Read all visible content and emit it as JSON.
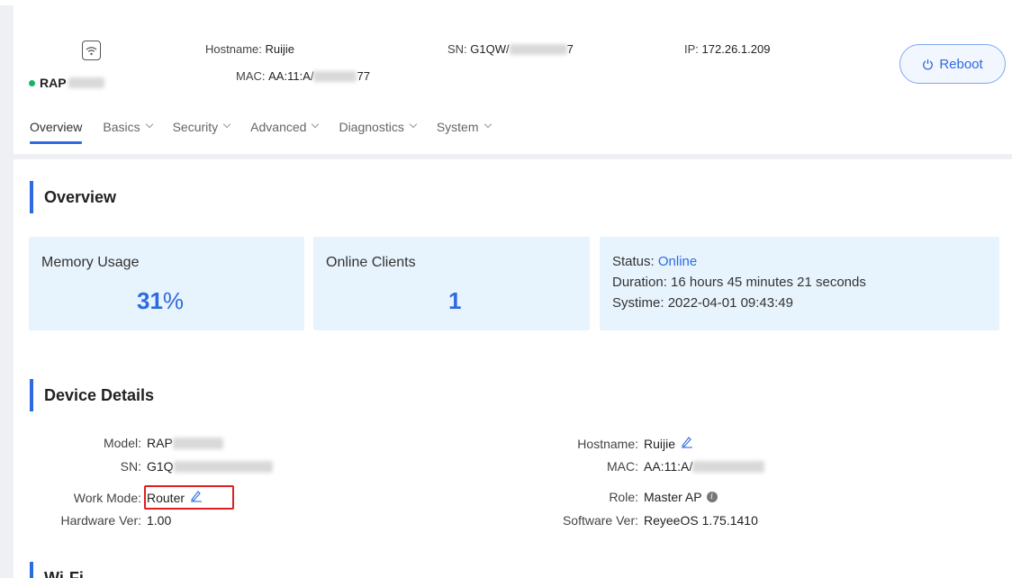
{
  "header": {
    "device_name": "RAP",
    "hostname_label": "Hostname:",
    "hostname_value": "Ruijie",
    "mac_label": "MAC:",
    "mac_prefix": "AA:11:A/",
    "mac_suffix": "77",
    "sn_label": "SN:",
    "sn_prefix": "G1QW/",
    "sn_suffix": "7",
    "ip_label": "IP:",
    "ip_value": "172.26.1.209",
    "reboot_label": "Reboot",
    "status_color": "#17b26a"
  },
  "nav": {
    "items": [
      {
        "label": "Overview",
        "has_dropdown": false,
        "active": true
      },
      {
        "label": "Basics",
        "has_dropdown": true
      },
      {
        "label": "Security",
        "has_dropdown": true
      },
      {
        "label": "Advanced",
        "has_dropdown": true
      },
      {
        "label": "Diagnostics",
        "has_dropdown": true
      },
      {
        "label": "System",
        "has_dropdown": true
      }
    ]
  },
  "overview": {
    "title": "Overview",
    "memory_label": "Memory Usage",
    "memory_value": "31",
    "memory_unit": "%",
    "clients_label": "Online Clients",
    "clients_value": "1",
    "status_label": "Status:",
    "status_value": "Online",
    "duration_label": "Duration:",
    "duration_value": "16 hours 45 minutes 21 seconds",
    "systime_label": "Systime:",
    "systime_value": "2022-04-01 09:43:49"
  },
  "device_details": {
    "title": "Device Details",
    "model_label": "Model:",
    "model_value": "RAP",
    "sn_label": "SN:",
    "sn_value": "G1Q",
    "work_mode_label": "Work Mode:",
    "work_mode_value": "Router",
    "hardware_label": "Hardware Ver:",
    "hardware_value": "1.00",
    "hostname_label": "Hostname:",
    "hostname_value": "Ruijie",
    "mac_label": "MAC:",
    "mac_value": "AA:11:A/",
    "role_label": "Role:",
    "role_value": "Master AP",
    "software_label": "Software Ver:",
    "software_value": "ReyeeOS 1.75.1410"
  },
  "wifi": {
    "title": "Wi-Fi"
  },
  "accent_color": "#2d6be0"
}
